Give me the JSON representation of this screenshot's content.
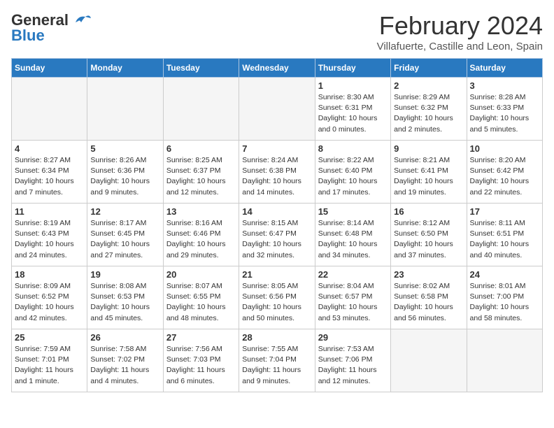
{
  "app": {
    "logo_line1": "General",
    "logo_line2": "Blue"
  },
  "calendar": {
    "title": "February 2024",
    "subtitle": "Villafuerte, Castille and Leon, Spain"
  },
  "weekdays": [
    "Sunday",
    "Monday",
    "Tuesday",
    "Wednesday",
    "Thursday",
    "Friday",
    "Saturday"
  ],
  "weeks": [
    [
      {
        "day": "",
        "info": ""
      },
      {
        "day": "",
        "info": ""
      },
      {
        "day": "",
        "info": ""
      },
      {
        "day": "",
        "info": ""
      },
      {
        "day": "1",
        "info": "Sunrise: 8:30 AM\nSunset: 6:31 PM\nDaylight: 10 hours\nand 0 minutes."
      },
      {
        "day": "2",
        "info": "Sunrise: 8:29 AM\nSunset: 6:32 PM\nDaylight: 10 hours\nand 2 minutes."
      },
      {
        "day": "3",
        "info": "Sunrise: 8:28 AM\nSunset: 6:33 PM\nDaylight: 10 hours\nand 5 minutes."
      }
    ],
    [
      {
        "day": "4",
        "info": "Sunrise: 8:27 AM\nSunset: 6:34 PM\nDaylight: 10 hours\nand 7 minutes."
      },
      {
        "day": "5",
        "info": "Sunrise: 8:26 AM\nSunset: 6:36 PM\nDaylight: 10 hours\nand 9 minutes."
      },
      {
        "day": "6",
        "info": "Sunrise: 8:25 AM\nSunset: 6:37 PM\nDaylight: 10 hours\nand 12 minutes."
      },
      {
        "day": "7",
        "info": "Sunrise: 8:24 AM\nSunset: 6:38 PM\nDaylight: 10 hours\nand 14 minutes."
      },
      {
        "day": "8",
        "info": "Sunrise: 8:22 AM\nSunset: 6:40 PM\nDaylight: 10 hours\nand 17 minutes."
      },
      {
        "day": "9",
        "info": "Sunrise: 8:21 AM\nSunset: 6:41 PM\nDaylight: 10 hours\nand 19 minutes."
      },
      {
        "day": "10",
        "info": "Sunrise: 8:20 AM\nSunset: 6:42 PM\nDaylight: 10 hours\nand 22 minutes."
      }
    ],
    [
      {
        "day": "11",
        "info": "Sunrise: 8:19 AM\nSunset: 6:43 PM\nDaylight: 10 hours\nand 24 minutes."
      },
      {
        "day": "12",
        "info": "Sunrise: 8:17 AM\nSunset: 6:45 PM\nDaylight: 10 hours\nand 27 minutes."
      },
      {
        "day": "13",
        "info": "Sunrise: 8:16 AM\nSunset: 6:46 PM\nDaylight: 10 hours\nand 29 minutes."
      },
      {
        "day": "14",
        "info": "Sunrise: 8:15 AM\nSunset: 6:47 PM\nDaylight: 10 hours\nand 32 minutes."
      },
      {
        "day": "15",
        "info": "Sunrise: 8:14 AM\nSunset: 6:48 PM\nDaylight: 10 hours\nand 34 minutes."
      },
      {
        "day": "16",
        "info": "Sunrise: 8:12 AM\nSunset: 6:50 PM\nDaylight: 10 hours\nand 37 minutes."
      },
      {
        "day": "17",
        "info": "Sunrise: 8:11 AM\nSunset: 6:51 PM\nDaylight: 10 hours\nand 40 minutes."
      }
    ],
    [
      {
        "day": "18",
        "info": "Sunrise: 8:09 AM\nSunset: 6:52 PM\nDaylight: 10 hours\nand 42 minutes."
      },
      {
        "day": "19",
        "info": "Sunrise: 8:08 AM\nSunset: 6:53 PM\nDaylight: 10 hours\nand 45 minutes."
      },
      {
        "day": "20",
        "info": "Sunrise: 8:07 AM\nSunset: 6:55 PM\nDaylight: 10 hours\nand 48 minutes."
      },
      {
        "day": "21",
        "info": "Sunrise: 8:05 AM\nSunset: 6:56 PM\nDaylight: 10 hours\nand 50 minutes."
      },
      {
        "day": "22",
        "info": "Sunrise: 8:04 AM\nSunset: 6:57 PM\nDaylight: 10 hours\nand 53 minutes."
      },
      {
        "day": "23",
        "info": "Sunrise: 8:02 AM\nSunset: 6:58 PM\nDaylight: 10 hours\nand 56 minutes."
      },
      {
        "day": "24",
        "info": "Sunrise: 8:01 AM\nSunset: 7:00 PM\nDaylight: 10 hours\nand 58 minutes."
      }
    ],
    [
      {
        "day": "25",
        "info": "Sunrise: 7:59 AM\nSunset: 7:01 PM\nDaylight: 11 hours\nand 1 minute."
      },
      {
        "day": "26",
        "info": "Sunrise: 7:58 AM\nSunset: 7:02 PM\nDaylight: 11 hours\nand 4 minutes."
      },
      {
        "day": "27",
        "info": "Sunrise: 7:56 AM\nSunset: 7:03 PM\nDaylight: 11 hours\nand 6 minutes."
      },
      {
        "day": "28",
        "info": "Sunrise: 7:55 AM\nSunset: 7:04 PM\nDaylight: 11 hours\nand 9 minutes."
      },
      {
        "day": "29",
        "info": "Sunrise: 7:53 AM\nSunset: 7:06 PM\nDaylight: 11 hours\nand 12 minutes."
      },
      {
        "day": "",
        "info": ""
      },
      {
        "day": "",
        "info": ""
      }
    ]
  ]
}
